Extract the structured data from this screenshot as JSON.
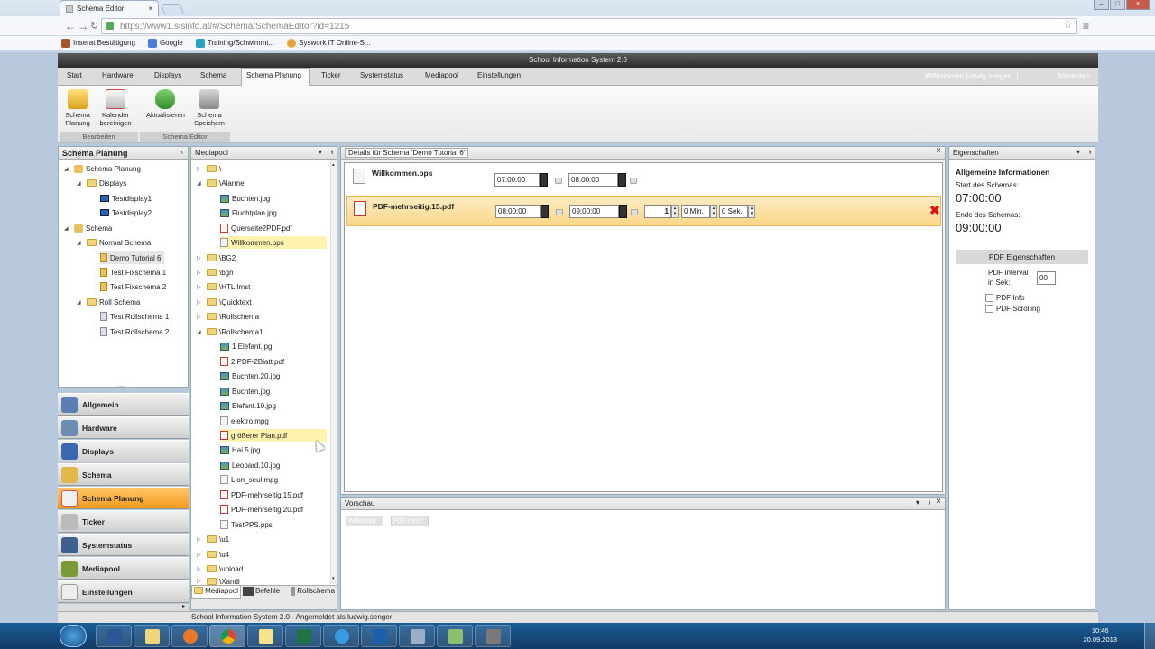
{
  "browser": {
    "tab_title": "Schema Editor",
    "url": "https://www1.sisinfo.at/#/Schema/SchemaEditor?id=1215",
    "bookmarks": [
      "Inserat Bestätigung",
      "Google",
      "Training/Schwimmt...",
      "Syswork IT Online-S..."
    ]
  },
  "app": {
    "title": "School Information System 2.0",
    "menu": [
      "Start",
      "Hardware",
      "Displays",
      "Schema",
      "Schema Planung",
      "Ticker",
      "Systemstatus",
      "Mediapool",
      "Einstellungen"
    ],
    "active_menu": "Schema Planung",
    "welcome": "Willkommen ludwig.senger",
    "logout": "Abmelden",
    "separator": "|"
  },
  "ribbon": {
    "groups": [
      {
        "label": "Bearbeiten",
        "buttons": [
          "Schema Planung",
          "Kalender bereinigen"
        ]
      },
      {
        "label": "Schema Editor",
        "buttons": [
          "Aktualisieren",
          "Schema Speichern"
        ]
      }
    ],
    "b1l1": "Schema",
    "b1l2": "Planung",
    "b2l1": "Kalender",
    "b2l2": "bereinigen",
    "b3l1": "Aktualisieren",
    "b4l1": "Schema",
    "b4l2": "Speichern"
  },
  "left_tree": {
    "header": "Schema Planung",
    "items": [
      "Schema Planung",
      "Displays",
      "Testdisplay1",
      "Testdisplay2",
      "Schema",
      "Normal Schema",
      "Demo Tutorial 6",
      "Test Fixschema 1",
      "Test Fixschema 2",
      "Roll Schema",
      "Test Rollschema 1",
      "Test Rollschema 2"
    ]
  },
  "nav_bar": {
    "items": [
      "Allgemein",
      "Hardware",
      "Displays",
      "Schema",
      "Schema Planung",
      "Ticker",
      "Systemstatus",
      "Mediapool",
      "Einstellungen"
    ],
    "active": "Schema Planung",
    "grip": "....",
    "collapse": "▸"
  },
  "mediapool": {
    "header": "Mediapool",
    "items": [
      "\\",
      "\\Alarme",
      "Buchten.jpg",
      "Fluchtplan.jpg",
      "Querseite2PDF.pdf",
      "Willkommen.pps",
      "\\BG2",
      "\\bgn",
      "\\HTL Imst",
      "\\Quicktext",
      "\\Rollschema",
      "\\Rollschema1",
      "1 Elefant.jpg",
      "2 PDF-2Blatt.pdf",
      "Buchten.20.jpg",
      "Buchten.jpg",
      "Elefant.10.jpg",
      "elektro.mpg",
      "größerer Plan.pdf",
      "Hai.5.jpg",
      "Leopard.10.jpg",
      "Lion_seul.mpg",
      "PDF-mehrseitig.15.pdf",
      "PDF-mehrseitig.20.pdf",
      "TestPPS.pps",
      "\\u1",
      "\\u4",
      "\\upload",
      "\\Xandi"
    ],
    "tabs": [
      "Mediapool",
      "Befehle",
      "Rollschema"
    ]
  },
  "details": {
    "header": "Details für Schema 'Demo Tutorial 6'",
    "rows": [
      {
        "name": "Willkommen.pps",
        "start": "07:00:00",
        "end": "08:00:00"
      },
      {
        "name": "PDF-mehrseitig.15.pdf",
        "start": "08:00:00",
        "end": "09:00:00",
        "count": "1",
        "min": "0 Min.",
        "sek": "0 Sek."
      }
    ]
  },
  "vorschau": {
    "header": "Vorschau",
    "buttons": [
      "Willkomm",
      "PDF-mehr"
    ]
  },
  "eigenschaften": {
    "header": "Eigenschaften",
    "section": "Allgemeine Informationen",
    "start_label": "Start des Schemas:",
    "start_value": "07:00:00",
    "end_label": "Ende des Schemas:",
    "end_value": "09:00:00",
    "pdf_button": "PDF Eigenschaften",
    "interval_label1": "PDF Interval",
    "interval_label2": "in Sek:",
    "interval_value": "00",
    "pdf_info": "PDF Info",
    "pdf_scrolling": "PDF Scrolling"
  },
  "status": "School Information System 2.0 - Angemeldet als ludwig.senger",
  "taskbar": {
    "time": "10:46",
    "date": "20.09.2013"
  },
  "colors": {
    "accent": "#f39a1a",
    "selection": "#fff3b0",
    "active_row": "#fde1a4"
  }
}
